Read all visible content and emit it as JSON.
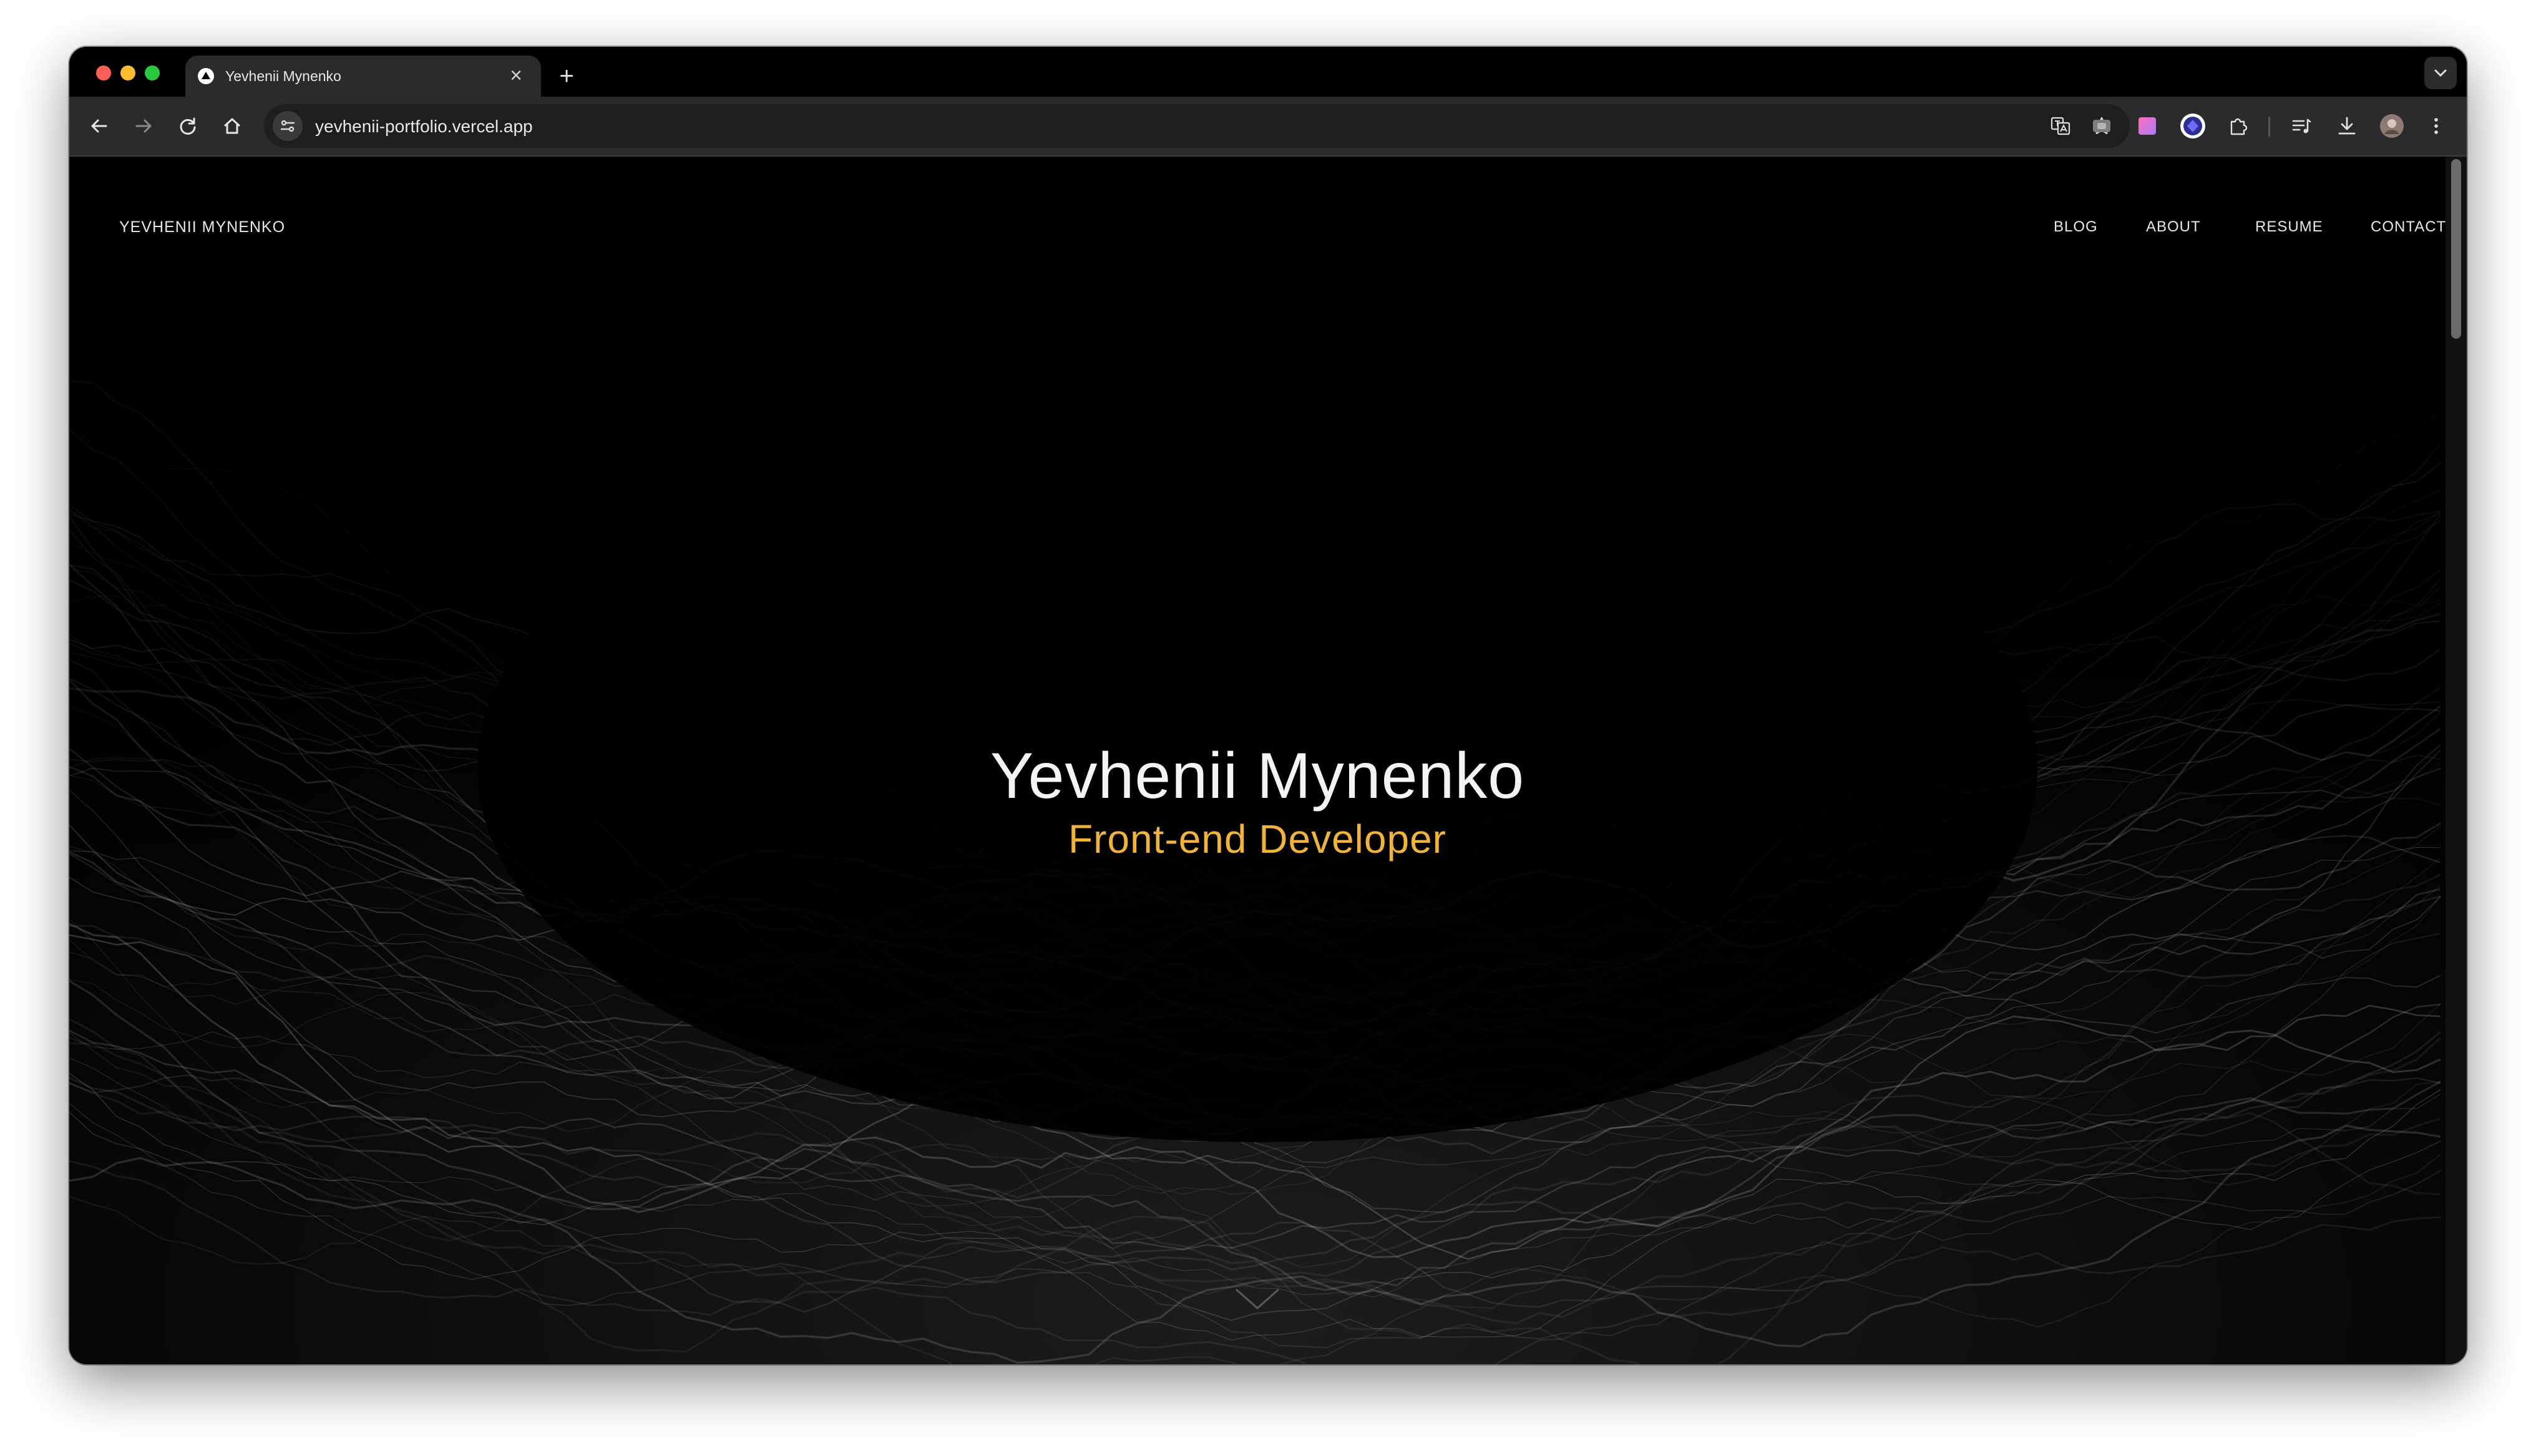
{
  "browser": {
    "tab_title": "Yevhenii Mynenko",
    "url": "yevhenii-portfolio.vercel.app"
  },
  "site": {
    "brand": "YEVHENII MYNENKO",
    "nav": [
      "BLOG",
      "ABOUT",
      "RESUME",
      "CONTACT"
    ],
    "hero_name": "Yevhenii Mynenko",
    "hero_role": "Front-end Developer"
  },
  "colors": {
    "accent": "#f0b43a",
    "background": "#000000",
    "text": "#f4f4f4"
  },
  "icons": {
    "navigation": [
      "back-icon",
      "forward-icon",
      "reload-icon",
      "home-icon"
    ],
    "omnibox": [
      "site-info-icon",
      "translate-icon",
      "bookmark-star-icon"
    ],
    "toolbar": [
      "extension-1-icon",
      "extension-2-icon",
      "extension-3-icon",
      "extensions-puzzle-icon",
      "reading-list-icon",
      "download-icon",
      "profile-avatar",
      "more-menu-icon"
    ],
    "page": [
      "chevron-down-icon"
    ]
  }
}
